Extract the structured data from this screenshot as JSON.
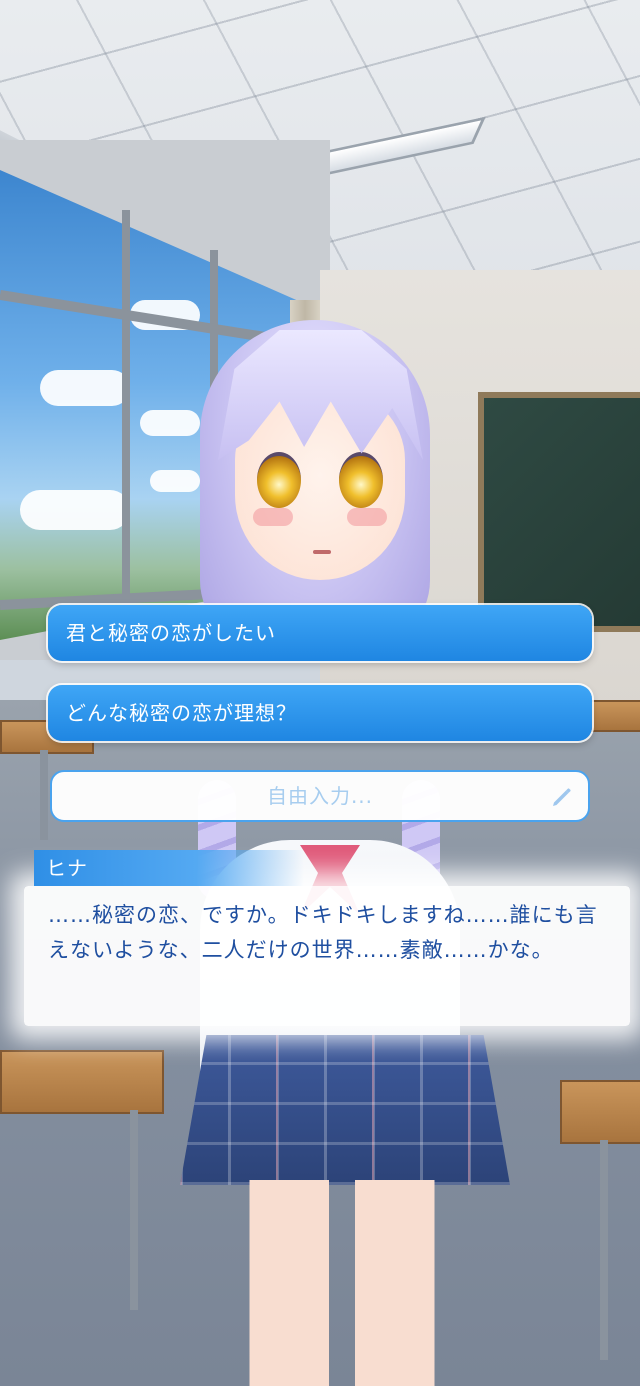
{
  "choices": [
    {
      "label": "君と秘密の恋がしたい"
    },
    {
      "label": "どんな秘密の恋が理想？"
    }
  ],
  "free_input": {
    "placeholder": "自由入力..."
  },
  "dialogue": {
    "speaker": "ヒナ",
    "text": "……秘密の恋、ですか。ドキドキしますね……誰にも言えないような、二人だけの世界……素敵……かな。"
  },
  "icons": {
    "pencil": "pencil-icon"
  },
  "colors": {
    "choice_button": "#2a95ec",
    "speaker_tag": "#2f8fe6",
    "dialogue_text": "#1f4fa0",
    "input_border": "#4aa3ee",
    "input_placeholder": "#a7cdef"
  }
}
